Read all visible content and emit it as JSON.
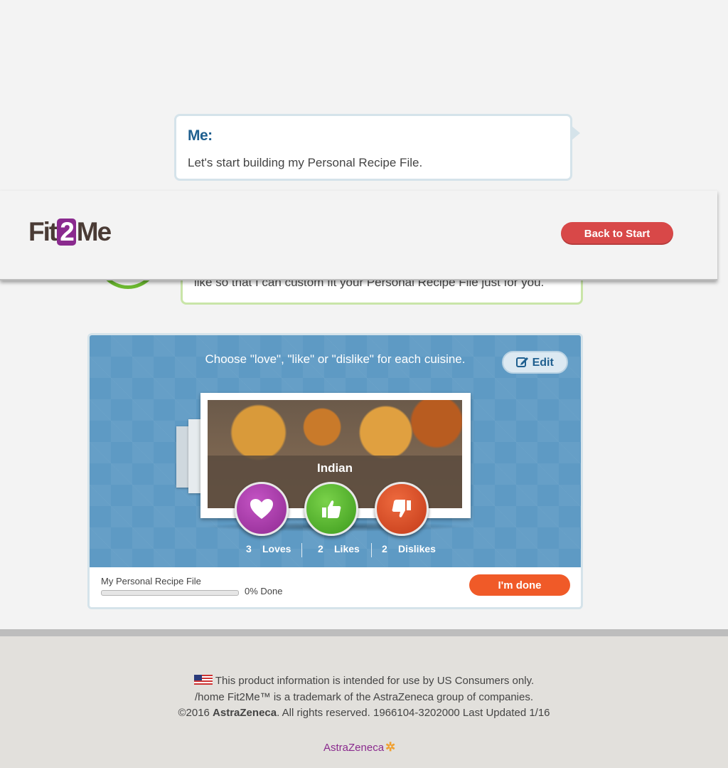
{
  "chat": {
    "me_label": "Me:",
    "me_message": "Let's start building my Personal Recipe File.",
    "bot_message": "like so that I can custom fit your Personal Recipe File just for you."
  },
  "header": {
    "logo_pre": "Fit",
    "logo_two": "2",
    "logo_post": "Me",
    "back_button": "Back to Start"
  },
  "activity": {
    "instruction": "Choose \"love\", \"like\" or \"dislike\" for each cuisine.",
    "edit_button": "Edit",
    "cuisine": "Indian",
    "counts": {
      "loves_num": "3",
      "loves_label": "Loves",
      "likes_num": "2",
      "likes_label": "Likes",
      "dislikes_num": "2",
      "dislikes_label": "Dislikes"
    },
    "file_label": "My Personal Recipe File",
    "progress_text": "0% Done",
    "progress_value": 0,
    "done_button": "I'm done"
  },
  "footer": {
    "line1": "This product information is intended for use by US Consumers only.",
    "line2": "/home Fit2Me™ is a trademark of the AstraZeneca group of companies.",
    "line3_pre": "©2016 ",
    "line3_bold": "AstraZeneca",
    "line3_post": ". All rights reserved. 1966104-3202000 Last Updated 1/16",
    "brand": "AstraZeneca"
  },
  "colors": {
    "accent_blue": "#5e9ac4",
    "back_red": "#d84848",
    "done_orange": "#f05a28",
    "love_purple": "#8f2a92",
    "like_green": "#3c9a1c",
    "dislike_red": "#c33a18"
  },
  "icons": [
    "heart-icon",
    "thumbs-up-icon",
    "thumbs-down-icon",
    "edit-icon",
    "us-flag-icon"
  ]
}
